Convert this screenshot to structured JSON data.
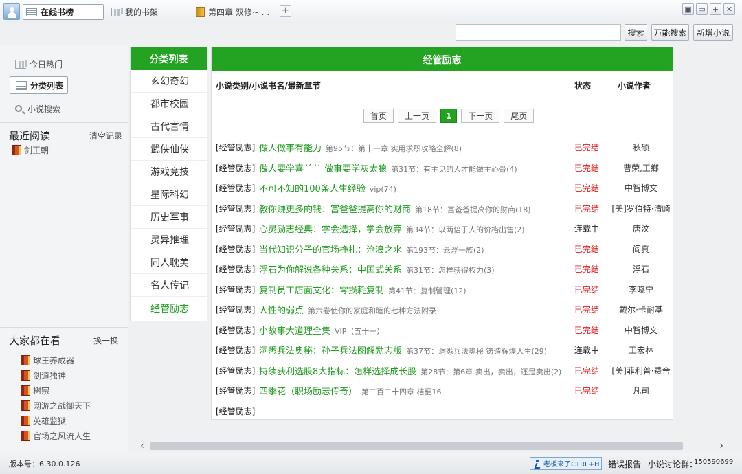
{
  "tabs": [
    {
      "label": "在线书榜",
      "icon": "list-icon",
      "active": true
    },
    {
      "label": "我的书架",
      "icon": "bookshelf-icon",
      "active": false
    },
    {
      "label": "第四章 双修~ . .",
      "icon": "book-icon",
      "active": false
    }
  ],
  "tab_add_label": "+",
  "window_buttons": [
    "▣",
    "▭",
    "+",
    "✕"
  ],
  "search": {
    "value": "",
    "placeholder": "",
    "search_label": "搜索",
    "universal_label": "万能搜索",
    "add_label": "新增小说"
  },
  "sidebar": {
    "nav": [
      {
        "label": "今日热门",
        "icon": "bookshelf-icon"
      },
      {
        "label": "分类列表",
        "icon": "list-icon",
        "active": true
      },
      {
        "label": "小说搜索",
        "icon": "search-icon"
      }
    ],
    "recent": {
      "title": "最近阅读",
      "clear_label": "清空记录",
      "items": [
        "剑王朝"
      ]
    },
    "popular": {
      "title": "大家都在看",
      "refresh_label": "换一换",
      "items": [
        "球王养成器",
        "剑道独神",
        "树宗",
        "网游之战御天下",
        "英雄监狱",
        "官场之风流人生"
      ]
    }
  },
  "categories": {
    "title": "分类列表",
    "items": [
      "玄幻奇幻",
      "都市校园",
      "古代言情",
      "武侠仙侠",
      "游戏竞技",
      "星际科幻",
      "历史军事",
      "灵异推理",
      "同人耽美",
      "名人传记",
      "经管励志"
    ],
    "active": "经管励志"
  },
  "main": {
    "title": "经管励志",
    "columns": {
      "name": "小说类别/小说书名/最新章节",
      "status": "状态",
      "author": "小说作者"
    },
    "pager": {
      "first": "首页",
      "prev": "上一页",
      "current": "1",
      "next": "下一页",
      "last": "尾页"
    },
    "rows": [
      {
        "tag": "[经管励志]",
        "title": "做人做事有能力",
        "chapter": "第95节：第十一章 实用求职攻略全解(8)",
        "status": "已完结",
        "author": "秋硕"
      },
      {
        "tag": "[经管励志]",
        "title": "做人要学喜羊羊 做事要学灰太狼",
        "chapter": "第31节：有主见的人才能做主心骨(4)",
        "status": "已完结",
        "author": "曹荣,王鄉"
      },
      {
        "tag": "[经管励志]",
        "title": "不可不知的100条人生经验",
        "chapter": "vip(74)",
        "status": "已完结",
        "author": "中智博文"
      },
      {
        "tag": "[经管励志]",
        "title": "教你赚更多的钱：富爸爸提高你的财商",
        "chapter": "第18节：富爸爸提高你的财商(18)",
        "status": "已完结",
        "author": "[美]罗伯特·清崎"
      },
      {
        "tag": "[经管励志]",
        "title": "心灵励志经典：学会选择，学会放弃",
        "chapter": "第34节：以两倍于人的价格出售(2)",
        "status": "连载中",
        "author": "唐汶"
      },
      {
        "tag": "[经管励志]",
        "title": "当代知识分子的官场挣扎：沧浪之水",
        "chapter": "第193节：悬浮一族(2)",
        "status": "已完结",
        "author": "阎真"
      },
      {
        "tag": "[经管励志]",
        "title": "浮石为你解说各种关系：中国式关系",
        "chapter": "第31节：怎样获得权力(3)",
        "status": "已完结",
        "author": "浮石"
      },
      {
        "tag": "[经管励志]",
        "title": "复制员工店面文化：零损耗复制",
        "chapter": "第41节：复制管理(12)",
        "status": "已完结",
        "author": "李晓宁"
      },
      {
        "tag": "[经管励志]",
        "title": "人性的弱点",
        "chapter": "第六卷使你的家庭和睦的七种方法附录",
        "status": "已完结",
        "author": "戴尔·卡耐基"
      },
      {
        "tag": "[经管励志]",
        "title": "小故事大道理全集",
        "chapter": "VIP（五十一）",
        "status": "已完结",
        "author": "中智博文"
      },
      {
        "tag": "[经管励志]",
        "title": "洞悉兵法奥秘：孙子兵法图解励志版",
        "chapter": "第37节：洞悉兵法奥秘 铸造辉煌人生(29)",
        "status": "连载中",
        "author": "王宏林"
      },
      {
        "tag": "[经管励志]",
        "title": "持续获利选股8大指标：怎样选择成长股",
        "chapter": "第28节：第6章 卖出，卖出，还是卖出(2)",
        "status": "已完结",
        "author": "[美]菲利普·费舍"
      },
      {
        "tag": "[经管励志]",
        "title": "四季花（职场励志传奇）",
        "chapter": "第二百二十四章 桔梗16",
        "status": "已完结",
        "author": "凡司"
      },
      {
        "tag": "[经管励志]",
        "title": "",
        "chapter": "",
        "status": "",
        "author": ""
      }
    ]
  },
  "statusbar": {
    "version": "版本号：6.30.0.126",
    "boss_label": "老板来了CTRL+H",
    "report_label": "错误报告",
    "group_label": "小说讨论群：",
    "group_number": "150590699"
  },
  "colors": {
    "accent": "#23a321",
    "title_green": "#1f9b1f",
    "done_red": "#e02020"
  }
}
